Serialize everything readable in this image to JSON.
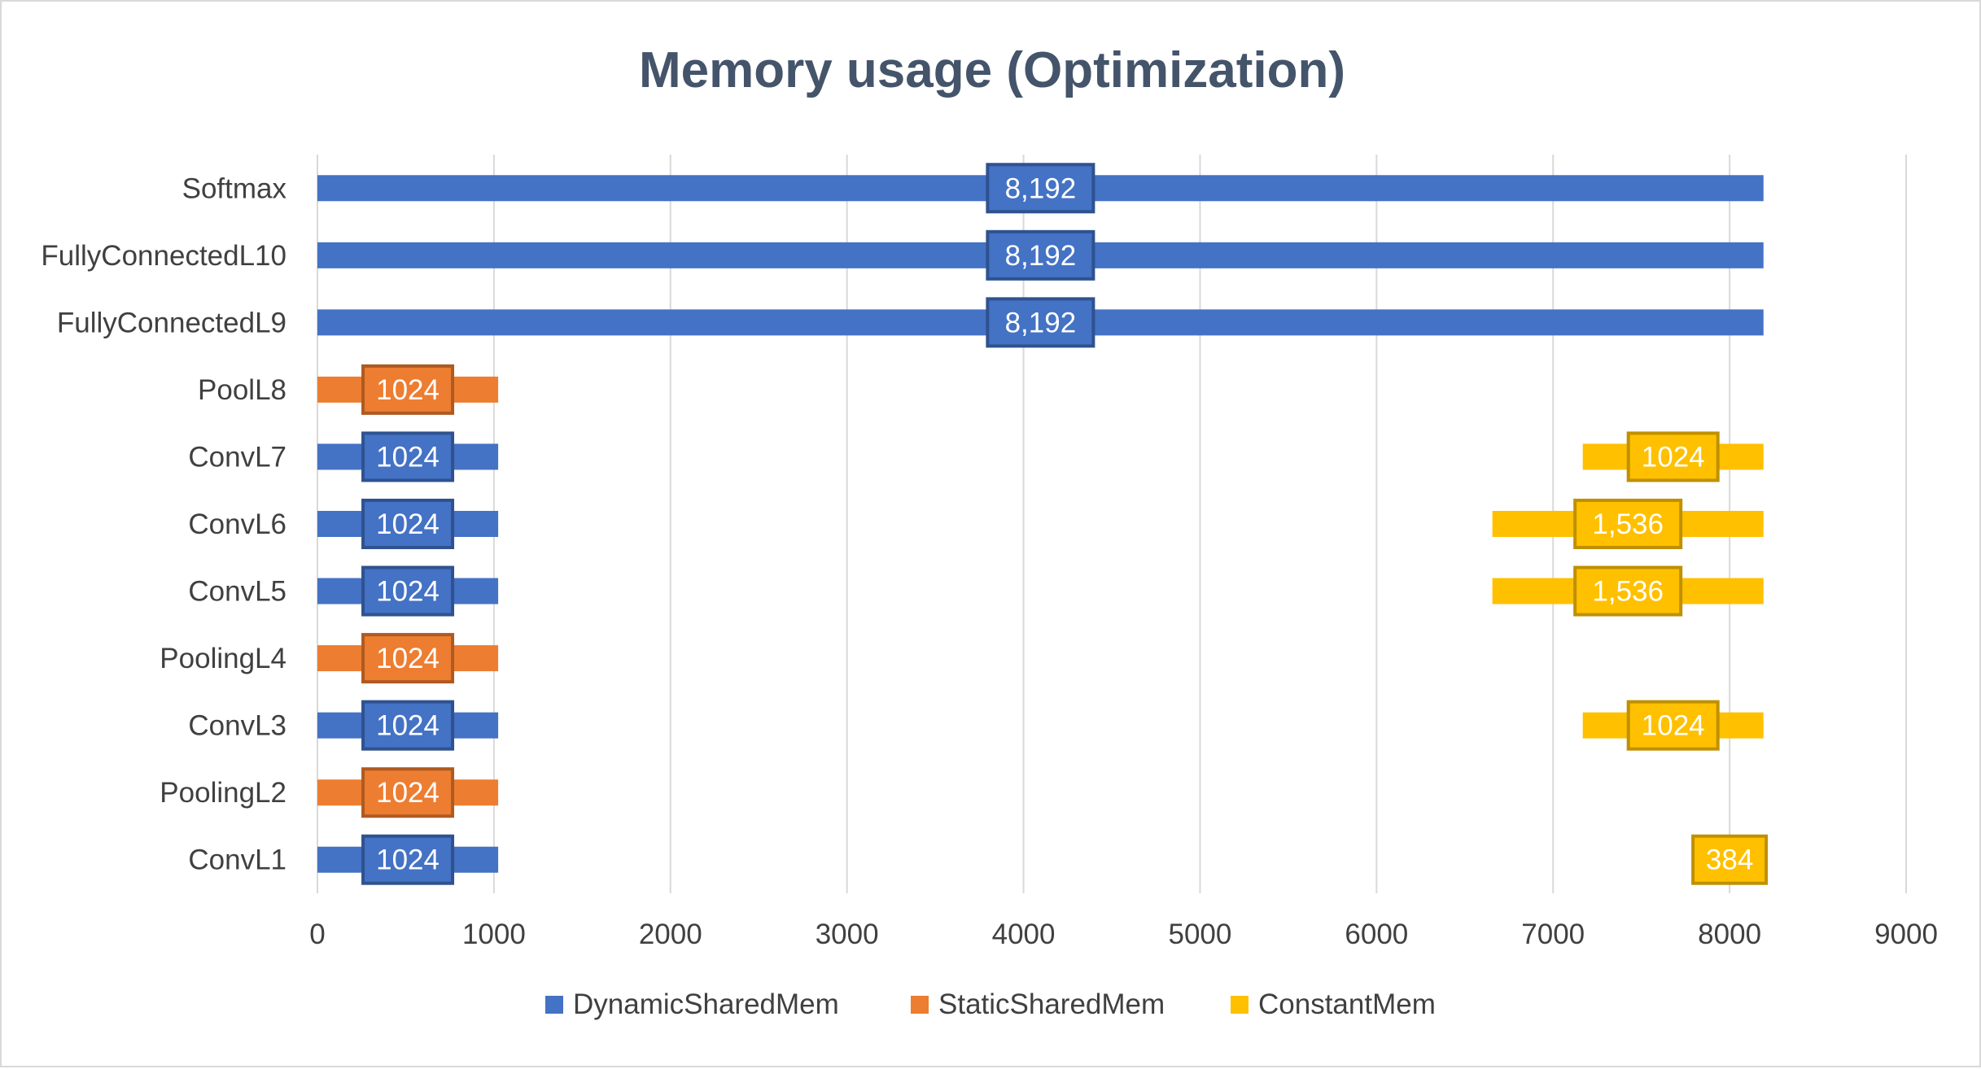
{
  "chart_data": {
    "type": "bar",
    "orientation": "horizontal",
    "stacked": true,
    "title": "Memory usage (Optimization)",
    "xlabel": "",
    "ylabel": "",
    "xlim": [
      0,
      9000
    ],
    "x_ticks": [
      0,
      1000,
      2000,
      3000,
      4000,
      5000,
      6000,
      7000,
      8000,
      9000
    ],
    "grid": "vertical",
    "legend_position": "bottom",
    "categories": [
      "ConvL1",
      "PoolingL2",
      "ConvL3",
      "PoolingL4",
      "ConvL5",
      "ConvL6",
      "ConvL7",
      "PoolL8",
      "FullyConnectedL9",
      "FullyConnectedL10",
      "Softmax"
    ],
    "series": [
      {
        "name": "DynamicSharedMem",
        "color": "#4472c4",
        "values": [
          1024,
          0,
          1024,
          0,
          1024,
          1024,
          1024,
          0,
          8192,
          8192,
          8192
        ],
        "data_labels": [
          "1024",
          "",
          "1024",
          "",
          "1024",
          "1024",
          "1024",
          "",
          "8,192",
          "8,192",
          "8,192"
        ]
      },
      {
        "name": "StaticSharedMem",
        "color": "#ed7d31",
        "values": [
          0,
          1024,
          0,
          1024,
          0,
          0,
          0,
          1024,
          0,
          0,
          0
        ],
        "data_labels": [
          "",
          "1024",
          "",
          "1024",
          "",
          "",
          "",
          "1024",
          "",
          "",
          ""
        ]
      },
      {
        "name": "ConstantMem",
        "color": "#ffc000",
        "values": [
          384,
          0,
          1024,
          0,
          1536,
          1536,
          1024,
          0,
          0,
          0,
          0
        ],
        "data_labels": [
          "384",
          "",
          "1024",
          "",
          "1,536",
          "1,536",
          "1024",
          "",
          "",
          "",
          ""
        ]
      }
    ],
    "constant_series_end": 8192
  }
}
